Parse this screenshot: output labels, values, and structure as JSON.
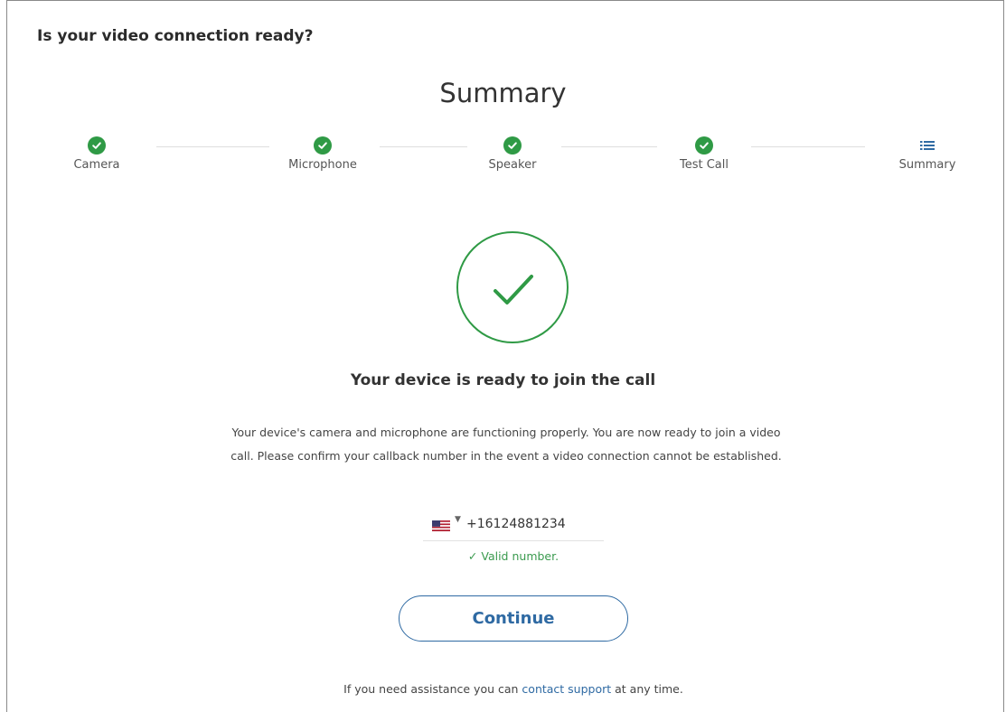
{
  "header": {
    "title": "Is your video connection ready?"
  },
  "page": {
    "title": "Summary"
  },
  "stepper": {
    "steps": [
      {
        "label": "Camera",
        "status": "complete"
      },
      {
        "label": "Microphone",
        "status": "complete"
      },
      {
        "label": "Speaker",
        "status": "complete"
      },
      {
        "label": "Test Call",
        "status": "complete"
      },
      {
        "label": "Summary",
        "status": "current"
      }
    ]
  },
  "result": {
    "icon": "check-circle-icon",
    "title": "Your device is ready to join the call",
    "description": "Your device's camera and microphone are functioning properly. You are now ready to join a video call. Please confirm your callback number in the event a video connection cannot be established."
  },
  "phone": {
    "country_flag_icon": "us-flag-icon",
    "value": "+16124881234",
    "validation_message": "Valid number."
  },
  "actions": {
    "continue_label": "Continue"
  },
  "footer": {
    "text_before": "If you need assistance you can ",
    "link_text": "contact support",
    "text_after": " at any time."
  },
  "colors": {
    "success": "#2f9a45",
    "accent": "#2f6aa3",
    "text": "#333333"
  }
}
